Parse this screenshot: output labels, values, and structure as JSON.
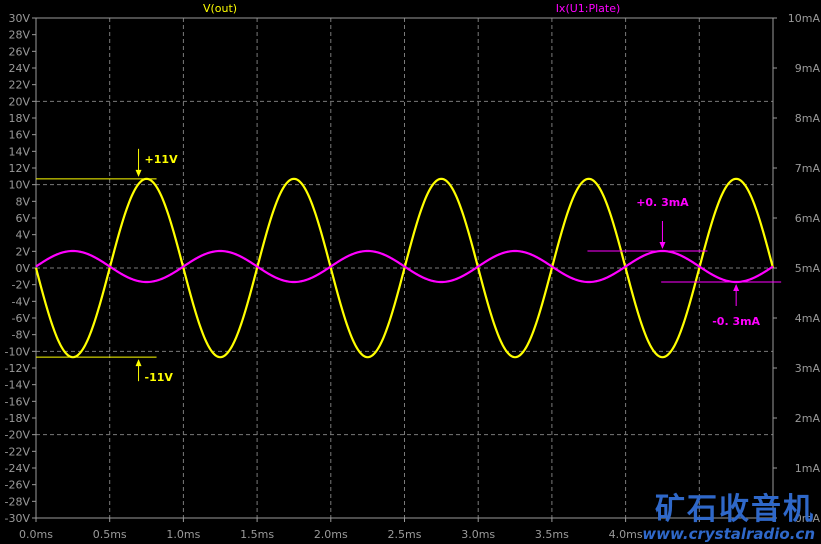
{
  "chart_data": {
    "type": "line",
    "legend": [
      "V(out)",
      "Ix(U1:Plate)"
    ],
    "x_axis": {
      "range": [
        0,
        5
      ],
      "unit": "ms",
      "ticks": [
        0,
        0.5,
        1,
        1.5,
        2,
        2.5,
        3,
        3.5,
        4,
        4.5,
        5
      ],
      "tick_labels": [
        "0.0ms",
        "0.5ms",
        "1.0ms",
        "1.5ms",
        "2.0ms",
        "2.5ms",
        "3.0ms",
        "3.5ms",
        "4.0ms",
        "",
        ""
      ]
    },
    "y_left": {
      "range": [
        -30,
        30
      ],
      "ticks": [
        30,
        28,
        26,
        24,
        22,
        20,
        18,
        16,
        14,
        12,
        10,
        8,
        6,
        4,
        2,
        0,
        -2,
        -4,
        -6,
        -8,
        -10,
        -12,
        -14,
        -16,
        -18,
        -20,
        -22,
        -24,
        -26,
        -28,
        -30
      ],
      "tick_labels": [
        "30V",
        "28V",
        "26V",
        "24V",
        "22V",
        "20V",
        "18V",
        "16V",
        "14V",
        "12V",
        "10V",
        "8V",
        "6V",
        "4V",
        "2V",
        "0V",
        "-2V",
        "-4V",
        "-6V",
        "-8V",
        "-10V",
        "-12V",
        "-14V",
        "-16V",
        "-18V",
        "-20V",
        "-22V",
        "-24V",
        "-26V",
        "-28V",
        "-30V"
      ]
    },
    "y_right": {
      "range": [
        0,
        10
      ],
      "ticks": [
        10,
        9,
        8,
        7,
        6,
        5,
        4,
        3,
        2,
        1,
        0
      ],
      "tick_labels": [
        "10mA",
        "9mA",
        "8mA",
        "7mA",
        "6mA",
        "5mA",
        "4mA",
        "3mA",
        "2mA",
        "1mA",
        "0mA"
      ]
    },
    "series": [
      {
        "name": "V(out)",
        "axis": "left",
        "color": "#ffff00",
        "waveform": "sine",
        "frequency_khz": 1,
        "amplitude": 10.7,
        "offset": 0,
        "phase_sign": -1,
        "x_range": [
          0,
          5
        ]
      },
      {
        "name": "Ix(U1:Plate)",
        "axis": "right",
        "color": "#ff00ff",
        "waveform": "sine",
        "frequency_khz": 1,
        "amplitude": 0.31,
        "offset": 5.03,
        "phase_sign": 1,
        "x_range": [
          0,
          5
        ]
      }
    ],
    "annotations": [
      {
        "text": "+11V",
        "color": "#ffff00",
        "x": 0.75,
        "y": 10.7,
        "axis": "left",
        "marker": "arrow-down"
      },
      {
        "text": "-11V",
        "color": "#ffff00",
        "x": 0.75,
        "y": -10.7,
        "axis": "left",
        "marker": "arrow-up"
      },
      {
        "text": "+0. 3mA",
        "color": "#ff00ff",
        "x": 4.25,
        "y": 5.34,
        "axis": "right",
        "marker": "arrow-down"
      },
      {
        "text": "-0. 3mA",
        "color": "#ff00ff",
        "x": 4.75,
        "y": 4.72,
        "axis": "right",
        "marker": "arrow-up"
      }
    ],
    "grid": true,
    "background": "#000000",
    "axis_color": "#9a9a9a",
    "label_color": "#9a9a9a"
  },
  "watermark": {
    "cn": "矿石收音机",
    "url": "www.crystalradio.cn"
  }
}
